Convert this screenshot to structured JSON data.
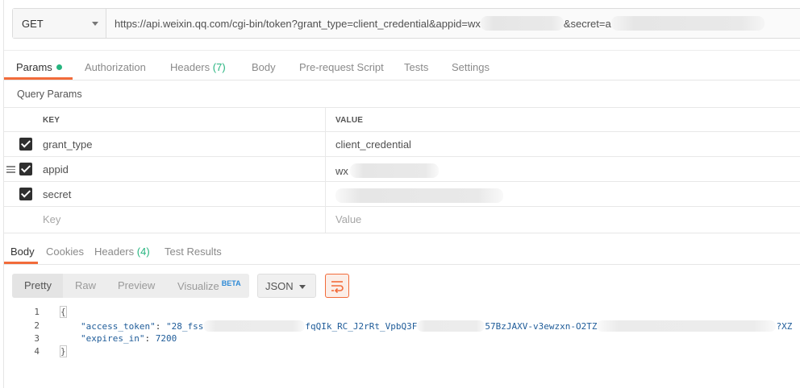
{
  "request": {
    "method": "GET",
    "url_visible_part1": "https://api.weixin.qq.com/cgi-bin/token?grant_type=client_credential&appid=wx",
    "url_visible_part2": "&secret=a"
  },
  "request_tabs": [
    {
      "label": "Params",
      "active": true,
      "dot": true
    },
    {
      "label": "Authorization"
    },
    {
      "label": "Headers",
      "count": "(7)"
    },
    {
      "label": "Body"
    },
    {
      "label": "Pre-request Script"
    },
    {
      "label": "Tests"
    },
    {
      "label": "Settings"
    }
  ],
  "query_params": {
    "title": "Query Params",
    "header_key": "KEY",
    "header_value": "VALUE",
    "rows": [
      {
        "key": "grant_type",
        "value": "client_credential",
        "checked": true
      },
      {
        "key": "appid",
        "value": "wx",
        "checked": true
      },
      {
        "key": "secret",
        "value": "",
        "checked": true
      }
    ],
    "placeholder_key": "Key",
    "placeholder_value": "Value"
  },
  "response_tabs": [
    {
      "label": "Body",
      "active": true
    },
    {
      "label": "Cookies"
    },
    {
      "label": "Headers",
      "count": "(4)"
    },
    {
      "label": "Test Results"
    }
  ],
  "format": {
    "options": [
      "Pretty",
      "Raw",
      "Preview",
      "Visualize"
    ],
    "selected": "Pretty",
    "visualize_badge": "BETA",
    "language": "JSON"
  },
  "response_body": {
    "line_numbers": [
      "1",
      "2",
      "3",
      "4"
    ],
    "open_brace": "{",
    "close_brace": "}",
    "access_token_key": "\"access_token\"",
    "access_token_part1": "\"28_fss",
    "access_token_part2": "fqQIk_RC_J2rRt_VpbQ3F",
    "access_token_part3": "57BzJAXV-v3ewzxn-O2TZ",
    "access_token_part4": "?XZ",
    "expires_in_key": "\"expires_in\"",
    "expires_in_value": "7200"
  },
  "colors": {
    "accent_orange": "#f26b3a",
    "count_green": "#26b47f",
    "beta_blue": "#2e8ad6"
  }
}
